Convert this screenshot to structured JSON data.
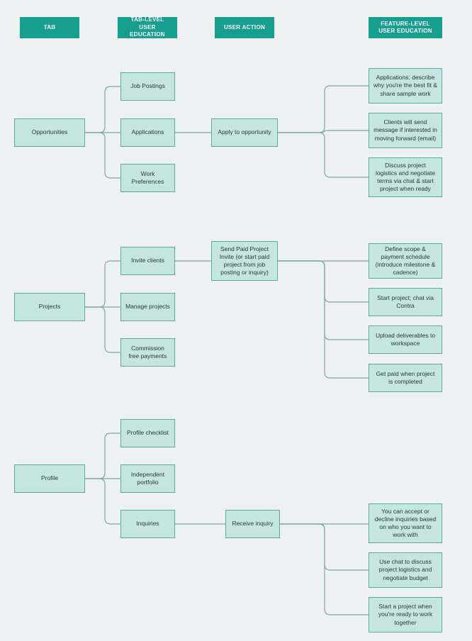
{
  "headers": {
    "tab": "TAB",
    "tabEdu": "TAB-LEVEL USER EDUCATION",
    "action": "USER ACTION",
    "featEdu": "FEATURE-LEVEL USER EDUCATION"
  },
  "rows": {
    "opportunities": {
      "tab": "Opportunities",
      "tabEdu": [
        "Job Postings",
        "Applications",
        "Work Preferences"
      ],
      "action": "Apply to opportunity",
      "featEdu": [
        "Applications: describe why you're the best fit & share sample work",
        "Clients will send message if interested in moving forward (email)",
        "Discuss project logistics and negotiate terms via chat & start project when ready"
      ]
    },
    "projects": {
      "tab": "Projects",
      "tabEdu": [
        "Invite clients",
        "Manage projects",
        "Commission free payments"
      ],
      "action": "Send Paid Project Invite (or start paid project from job posting or inquiry)",
      "featEdu": [
        "Define scope & payment schedule (introduce milestone & cadence)",
        "Start project; chat via Contra",
        "Upload deliverables to workspace",
        "Get paid when project is completed"
      ]
    },
    "profile": {
      "tab": "Profile",
      "tabEdu": [
        "Profile checklist",
        "Independent portfolio",
        "Inquiries"
      ],
      "action": "Receive inquiry",
      "featEdu": [
        "You can accept or decline inquiries based on who you want to work with",
        "Use chat to discuss project logistics and negotiate budget",
        "Start a project when you're ready to work together"
      ]
    }
  }
}
